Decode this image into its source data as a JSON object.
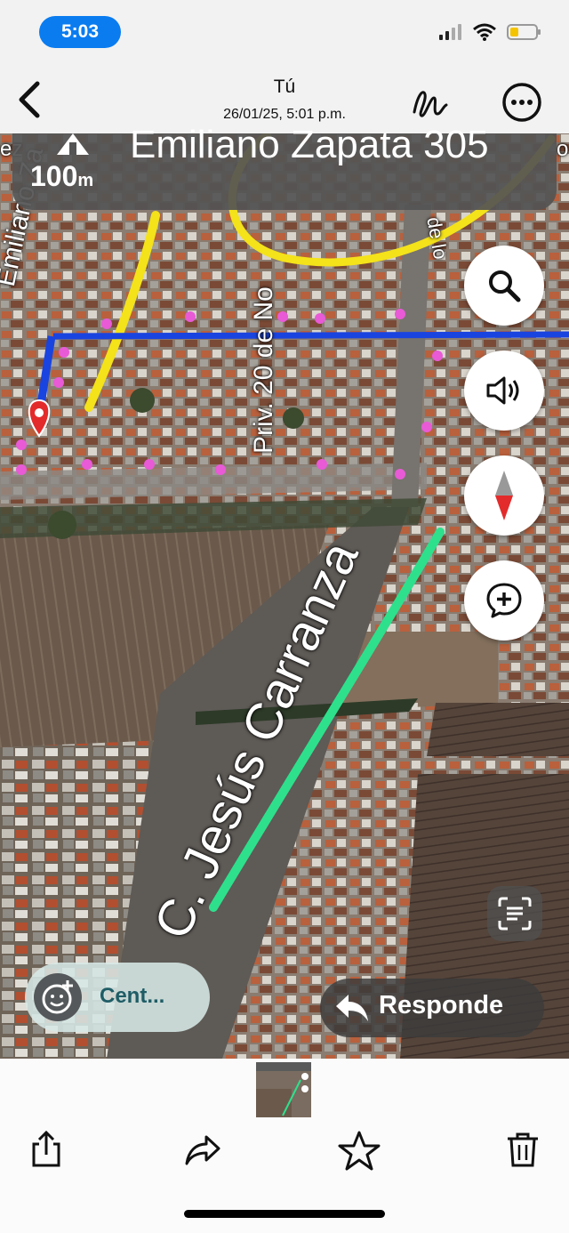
{
  "status_bar": {
    "time": "5:03",
    "icons": [
      "signal-icon",
      "wifi-icon",
      "battery-icon"
    ]
  },
  "header": {
    "title": "Tú",
    "subtitle": "26/01/25, 5:01 p.m."
  },
  "nav_banner": {
    "street": "Emiliano Zapata 305",
    "distance": "100",
    "unit": "m"
  },
  "map": {
    "labels": {
      "emiliano": "Emiliano Za",
      "priv": "Priv. 20 de No",
      "carranza": "C. Jesús Carranza",
      "corner_left": "ez",
      "corner_right": "o",
      "top_right": "de lo"
    },
    "colors": {
      "yellow_marker": "#f4e21a",
      "green_marker": "#2ee08c",
      "blue_route": "#1a44e0",
      "pink_dots": "#e85ad6"
    },
    "controls": [
      "search-icon",
      "speaker-icon",
      "compass-icon",
      "report-icon"
    ]
  },
  "overlay": {
    "left_pill_label": "Cent...",
    "right_pill_label": "Responde"
  },
  "toolbar": [
    "share-icon",
    "forward-icon",
    "star-icon",
    "trash-icon"
  ]
}
